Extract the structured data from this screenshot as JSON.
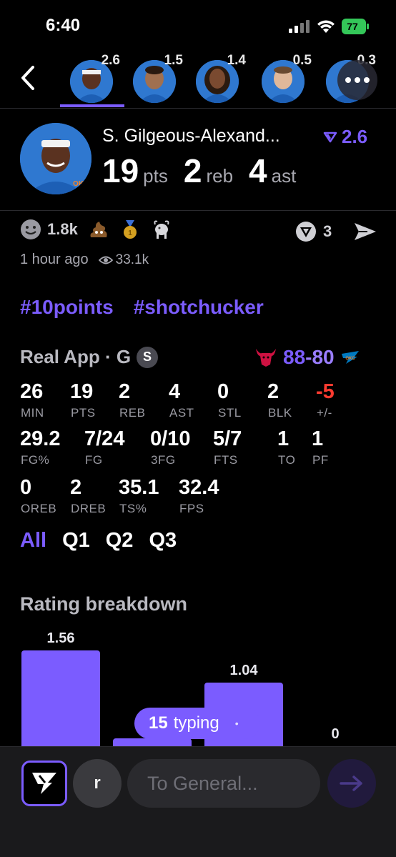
{
  "status_bar": {
    "time": "6:40",
    "battery": "77"
  },
  "strip": {
    "players": [
      {
        "score": "2.6"
      },
      {
        "score": "1.5"
      },
      {
        "score": "1.4"
      },
      {
        "score": "0.5"
      },
      {
        "score": "0.3"
      }
    ]
  },
  "player": {
    "name": "S. Gilgeous-Alexand...",
    "rating": "2.6",
    "pts": "19",
    "pts_unit": "pts",
    "reb": "2",
    "reb_unit": "reb",
    "ast": "4",
    "ast_unit": "ast"
  },
  "post": {
    "reaction_count": "1.8k",
    "vote_count": "3",
    "time_ago": "1 hour ago",
    "views": "33.1k",
    "tags": [
      "#10points",
      "#shotchucker"
    ]
  },
  "game": {
    "header": "Real App · G",
    "badge": "S",
    "home_score": "88",
    "separator": "-",
    "away_score": "80"
  },
  "box_score": {
    "row1": [
      {
        "value": "26",
        "label": "MIN"
      },
      {
        "value": "19",
        "label": "PTS"
      },
      {
        "value": "2",
        "label": "REB"
      },
      {
        "value": "4",
        "label": "AST"
      },
      {
        "value": "0",
        "label": "STL"
      },
      {
        "value": "2",
        "label": "BLK"
      },
      {
        "value": "-5",
        "label": "+/-"
      }
    ],
    "row2": [
      {
        "value": "29.2",
        "label": "FG%"
      },
      {
        "value": "7/24",
        "label": "FG"
      },
      {
        "value": "0/10",
        "label": "3FG"
      },
      {
        "value": "5/7",
        "label": "FTS"
      },
      {
        "value": "1",
        "label": "TO"
      },
      {
        "value": "1",
        "label": "PF"
      }
    ],
    "row3": [
      {
        "value": "0",
        "label": "OREB"
      },
      {
        "value": "2",
        "label": "DREB"
      },
      {
        "value": "35.1",
        "label": "TS%"
      },
      {
        "value": "32.4",
        "label": "FPS"
      }
    ]
  },
  "quarters": [
    "All",
    "Q1",
    "Q2",
    "Q3"
  ],
  "rating_breakdown": {
    "title": "Rating breakdown"
  },
  "chart_data": {
    "type": "bar",
    "title": "Rating breakdown",
    "values": [
      1.56,
      0.13,
      1.04,
      0
    ],
    "value_labels": [
      "1.56",
      "0.13",
      "1.04",
      "0"
    ]
  },
  "typing": {
    "count": "15",
    "label": "typing"
  },
  "composer": {
    "avatar_letter": "r",
    "placeholder": "To General..."
  },
  "colors": {
    "accent": "#7b5cff",
    "negative": "#ff3b30",
    "background": "#000000"
  },
  "icons": [
    "back-chevron-icon",
    "more-icon",
    "smiley-icon",
    "poop-icon",
    "medal-icon",
    "goat-icon",
    "vote-icon",
    "share-icon",
    "eye-icon",
    "bulls-logo-icon",
    "thunder-logo-icon",
    "real-logo-icon",
    "send-icon"
  ]
}
